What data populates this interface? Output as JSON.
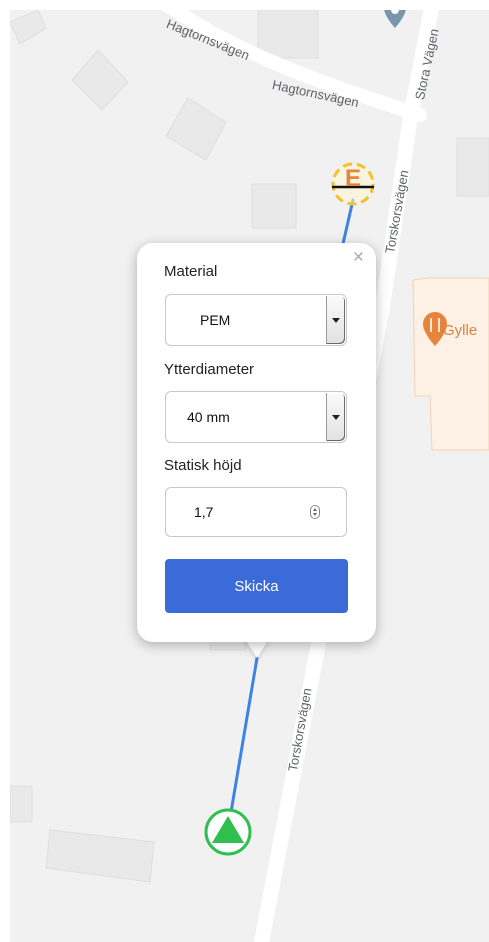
{
  "map": {
    "roads": {
      "hagtorn_1": "Hagtornsvägen",
      "hagtorn_2": "Hagtornsvägen",
      "stora": "Stora Vägen",
      "torskors_1": "Torskorsvägen",
      "torskors_2": "Torskorsvägen"
    },
    "poi": {
      "label": "Gylle",
      "icon": "restaurant-icon"
    },
    "markers": {
      "end": {
        "letter": "E",
        "icon": "end-marker-icon",
        "color": "#f2c12e"
      },
      "start": {
        "icon": "start-triangle-icon",
        "color": "#2fbf4f"
      }
    },
    "pipe_color": "#3c83e6"
  },
  "popup": {
    "close_label": "×",
    "material_label": "Material",
    "material_value": "PEM",
    "diameter_label": "Ytterdiameter",
    "diameter_value": "40 mm",
    "height_label": "Statisk höjd",
    "height_value": "1,7",
    "submit_label": "Skicka",
    "accent_color": "#3b6bd8"
  }
}
